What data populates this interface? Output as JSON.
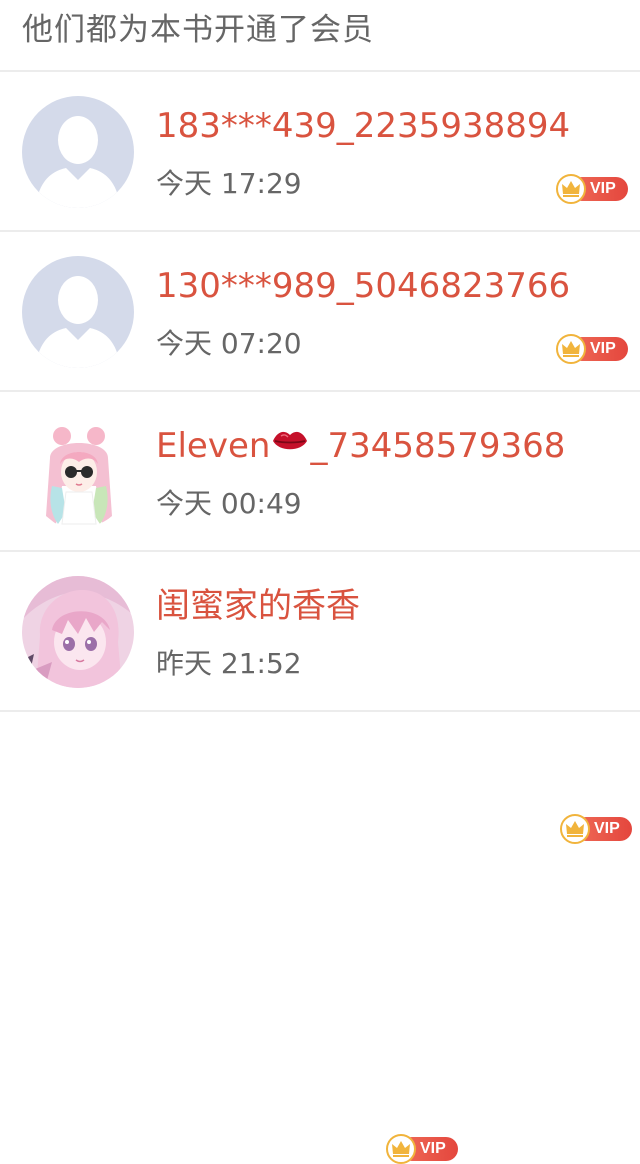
{
  "header": {
    "title": "他们都为本书开通了会员"
  },
  "badge": {
    "label": "VIP"
  },
  "members": [
    {
      "name": "183***439_2235938894",
      "time": "今天 17:29",
      "avatar": "default-user-avatar"
    },
    {
      "name": "130***989_5046823766",
      "time": "今天 07:20",
      "avatar": "default-user-avatar"
    },
    {
      "name_prefix": "Eleven",
      "name_emoji": "lips-icon",
      "name_suffix": "_73458579368",
      "time": "今天 00:49",
      "avatar": "anime-girl-sunglasses-avatar"
    },
    {
      "name": "闺蜜家的香香",
      "time": "昨天 21:52",
      "avatar": "anime-girl-pink-avatar"
    }
  ],
  "colors": {
    "name_red": "#d9533f",
    "time_gray": "#666666",
    "vip_red": "#e4463d",
    "crown_gold": "#f1b43c",
    "divider": "#ececec"
  }
}
